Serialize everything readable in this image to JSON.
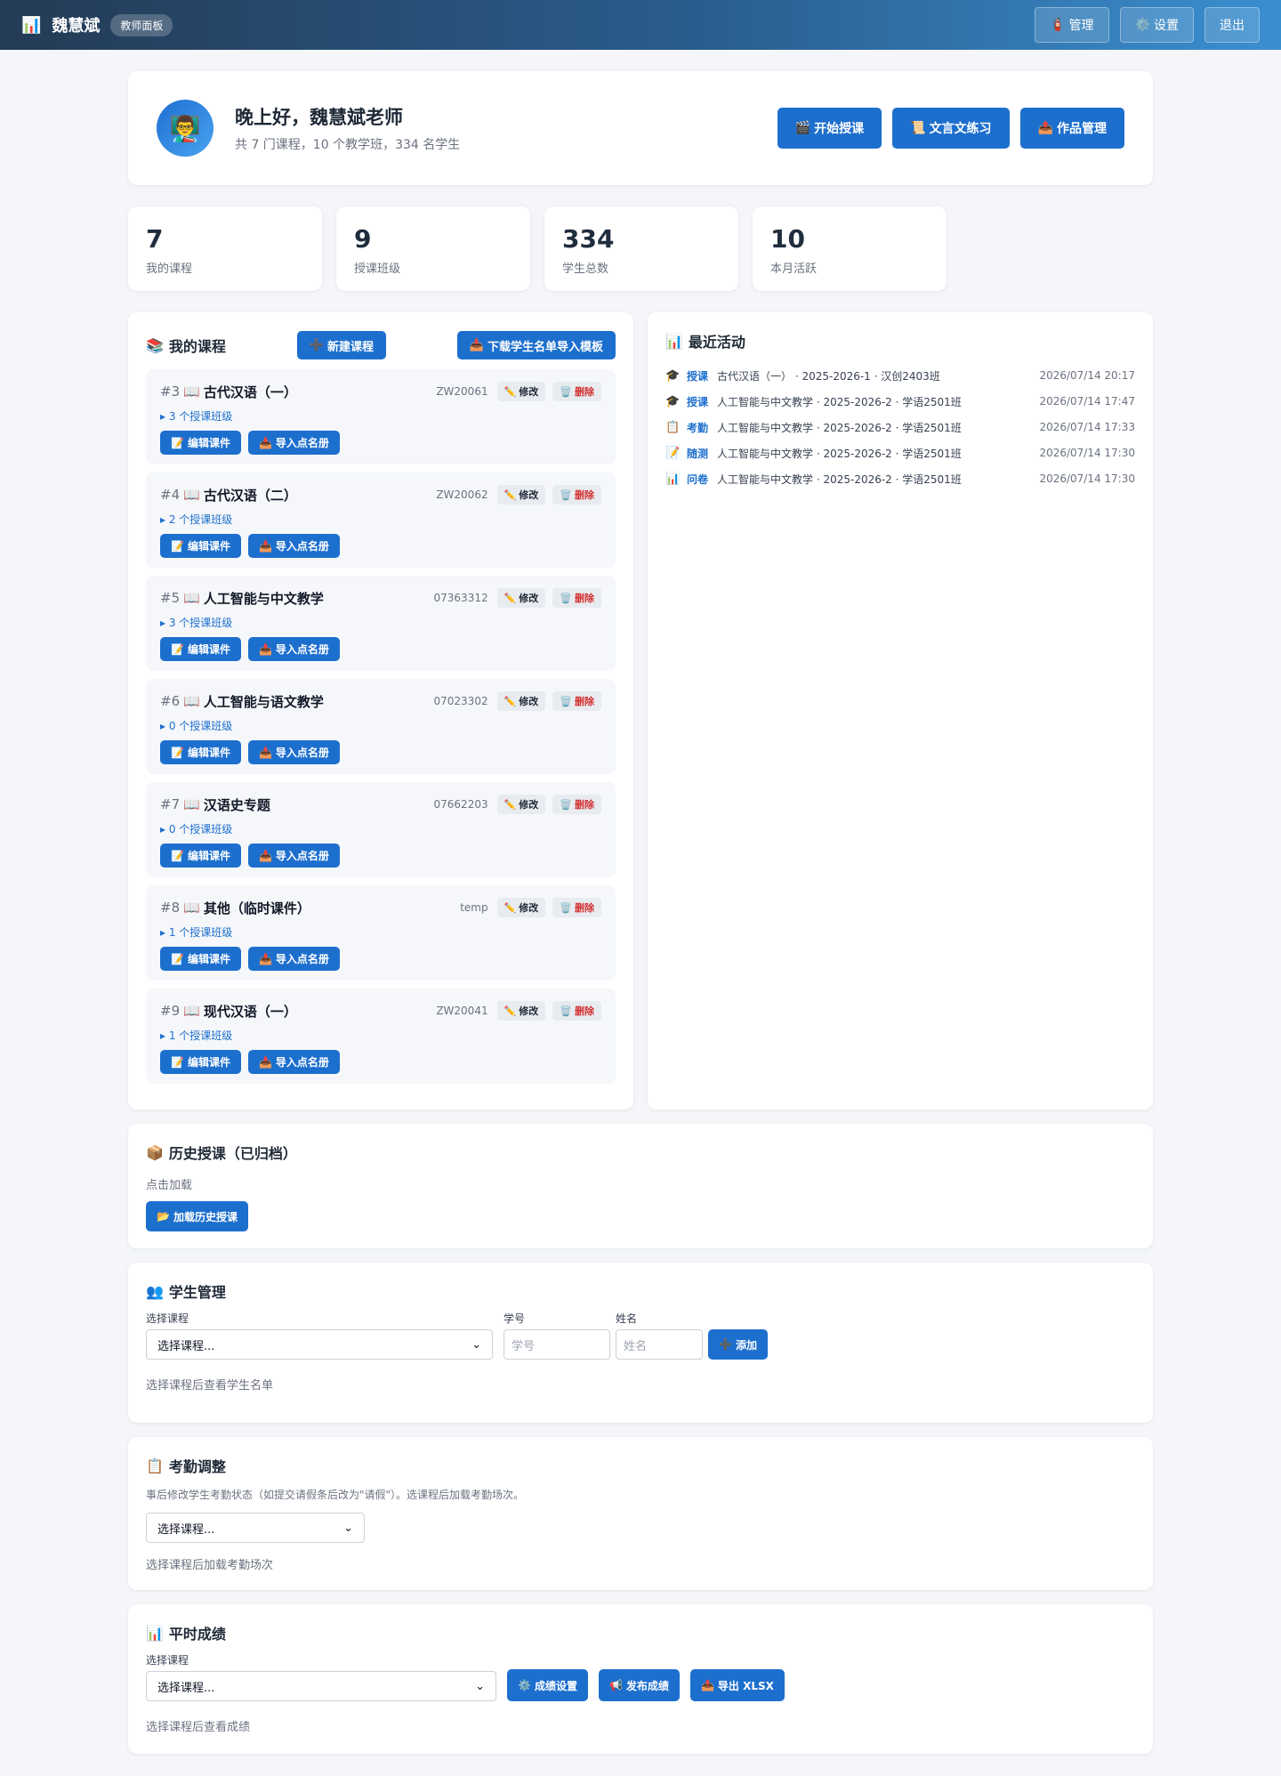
{
  "topbar": {
    "icon": "📊",
    "name": "魏慧斌",
    "badge": "教师面板",
    "actions": [
      {
        "icon": "🧯",
        "label": "管理"
      },
      {
        "icon": "⚙️",
        "label": "设置"
      },
      {
        "icon": "",
        "label": "退出"
      }
    ]
  },
  "welcome": {
    "avatar": "👨‍🏫",
    "greeting": "晚上好，魏慧斌老师",
    "summary": "共 7 门课程，10 个教学班，334 名学生",
    "actions": [
      {
        "icon": "🎬",
        "label": "开始授课"
      },
      {
        "icon": "📜",
        "label": "文言文练习"
      },
      {
        "icon": "📤",
        "label": "作品管理"
      }
    ]
  },
  "stats": [
    {
      "value": "7",
      "label": "我的课程"
    },
    {
      "value": "9",
      "label": "授课班级"
    },
    {
      "value": "334",
      "label": "学生总数"
    },
    {
      "value": "10",
      "label": "本月活跃"
    }
  ],
  "courses": {
    "title_icon": "📚",
    "title": "我的课程",
    "new_button": {
      "icon": "➕",
      "label": "新建课程"
    },
    "template_button": {
      "icon": "📥",
      "label": "下载学生名单导入模板"
    },
    "edit_label": "修改",
    "edit_icon": "✏️",
    "delete_label": "删除",
    "delete_icon": "🗑️",
    "courseware_label": "编辑课件",
    "courseware_icon": "📝",
    "import_label": "导入点名册",
    "import_icon": "📥",
    "book_icon": "📖",
    "items": [
      {
        "no": "#3",
        "name": "古代汉语（一）",
        "code": "ZW20061",
        "classes": "▸ 3 个授课班级"
      },
      {
        "no": "#4",
        "name": "古代汉语（二）",
        "code": "ZW20062",
        "classes": "▸ 2 个授课班级"
      },
      {
        "no": "#5",
        "name": "人工智能与中文教学",
        "code": "07363312",
        "classes": "▸ 3 个授课班级"
      },
      {
        "no": "#6",
        "name": "人工智能与语文教学",
        "code": "07023302",
        "classes": "▸ 0 个授课班级"
      },
      {
        "no": "#7",
        "name": "汉语史专题",
        "code": "07662203",
        "classes": "▸ 0 个授课班级"
      },
      {
        "no": "#8",
        "name": "其他（临时课件）",
        "code": "temp",
        "classes": "▸ 1 个授课班级"
      },
      {
        "no": "#9",
        "name": "现代汉语（一）",
        "code": "ZW20041",
        "classes": "▸ 1 个授课班级"
      }
    ]
  },
  "activity": {
    "title_icon": "📊",
    "title": "最近活动",
    "items": [
      {
        "icon": "🎓",
        "type": "授课",
        "desc": "古代汉语（一） · 2025-2026-1 · 汉创2403班",
        "time": "2026/07/14 20:17"
      },
      {
        "icon": "🎓",
        "type": "授课",
        "desc": "人工智能与中文教学 · 2025-2026-2 · 学语2501班",
        "time": "2026/07/14 17:47"
      },
      {
        "icon": "📋",
        "type": "考勤",
        "desc": "人工智能与中文教学 · 2025-2026-2 · 学语2501班",
        "time": "2026/07/14 17:33"
      },
      {
        "icon": "📝",
        "type": "随测",
        "desc": "人工智能与中文教学 · 2025-2026-2 · 学语2501班",
        "time": "2026/07/14 17:30"
      },
      {
        "icon": "📊",
        "type": "问卷",
        "desc": "人工智能与中文教学 · 2025-2026-2 · 学语2501班",
        "time": "2026/07/14 17:30"
      }
    ]
  },
  "history": {
    "title_icon": "📦",
    "title": "历史授课（已归档）",
    "hint": "点击加载",
    "button_icon": "📂",
    "button": "加载历史授课"
  },
  "students": {
    "title_icon": "👥",
    "title": "学生管理",
    "course_label": "选择课程",
    "course_value": "选择课程...",
    "id_label": "学号",
    "id_placeholder": "学号",
    "name_label": "姓名",
    "name_placeholder": "姓名",
    "add_icon": "➕",
    "add_button": "添加",
    "hint": "选择课程后查看学生名单"
  },
  "attendance": {
    "title_icon": "📋",
    "title": "考勤调整",
    "desc": "事后修改学生考勤状态（如提交请假条后改为\"请假\"）。选课程后加载考勤场次。",
    "select_value": "选择课程...",
    "hint": "选择课程后加载考勤场次"
  },
  "grades": {
    "title_icon": "📊",
    "title": "平时成绩",
    "course_label": "选择课程",
    "select_value": "选择课程...",
    "buttons": [
      {
        "icon": "⚙️",
        "label": "成绩设置"
      },
      {
        "icon": "📢",
        "label": "发布成绩"
      },
      {
        "icon": "📤",
        "label": "导出 XLSX"
      }
    ],
    "hint": "选择课程后查看成绩"
  },
  "colors": {
    "primary": "#1d6fce",
    "danger": "#d32f2f",
    "header_start": "#243b55",
    "header_end": "#3a8fd0"
  }
}
